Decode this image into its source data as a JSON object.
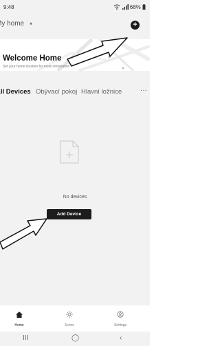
{
  "status": {
    "time": "9:48",
    "indicators": "68%"
  },
  "home": {
    "title": "My home",
    "caret": "▾",
    "add_symbol": "+"
  },
  "banner": {
    "title": "Welcome Home",
    "subtitle": "Set your home location for more information"
  },
  "tabs": {
    "items": [
      {
        "label": "All Devices"
      },
      {
        "label": "Obývací pokoj"
      },
      {
        "label": "Hlavní ložnice"
      }
    ],
    "more": "···"
  },
  "empty": {
    "message": "No devices",
    "button": "Add Device"
  },
  "tabbar": {
    "items": [
      {
        "label": "Home",
        "icon": "home-icon"
      },
      {
        "label": "Scene",
        "icon": "scene-icon"
      },
      {
        "label": "Settings",
        "icon": "settings-icon"
      }
    ]
  },
  "sysnav": {
    "recents": "III",
    "home": "◯",
    "back": "‹"
  }
}
